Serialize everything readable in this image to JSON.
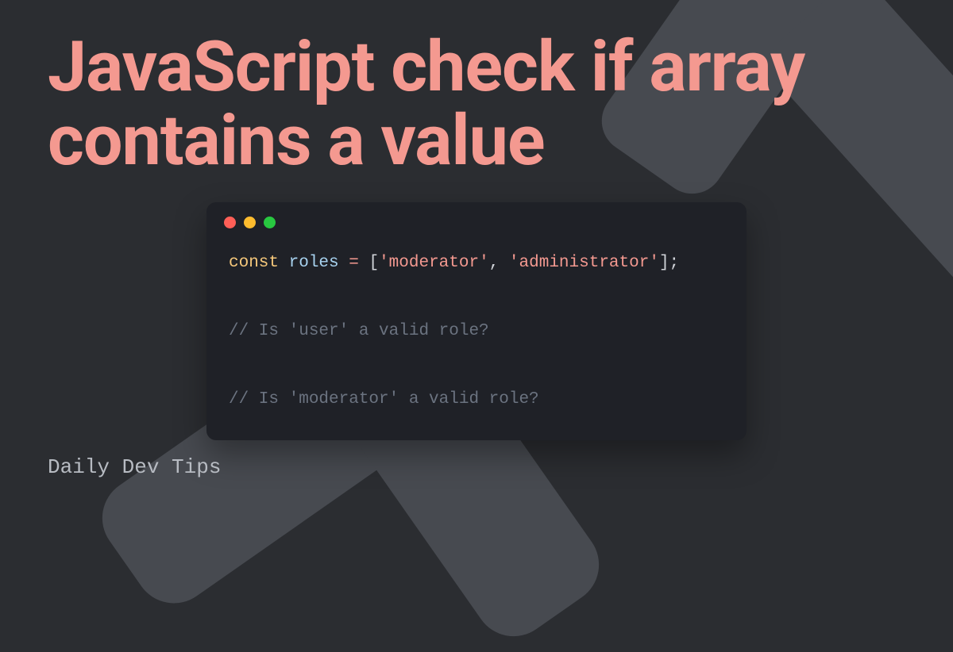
{
  "title": "JavaScript check if array contains a value",
  "code": {
    "keyword_const": "const",
    "ident_roles": "roles",
    "op_eq": " = ",
    "arr_open": "[",
    "str_mod": "'moderator'",
    "comma_sp": ", ",
    "str_admin": "'administrator'",
    "arr_close_semi": "];",
    "comment_user": "// Is 'user' a valid role?",
    "comment_moderator": "// Is 'moderator' a valid role?"
  },
  "site_name": "Daily Dev Tips",
  "colors": {
    "accent": "#f49990",
    "bg": "#2b2d31",
    "shape": "#474a50",
    "code_bg": "#1f2127"
  }
}
